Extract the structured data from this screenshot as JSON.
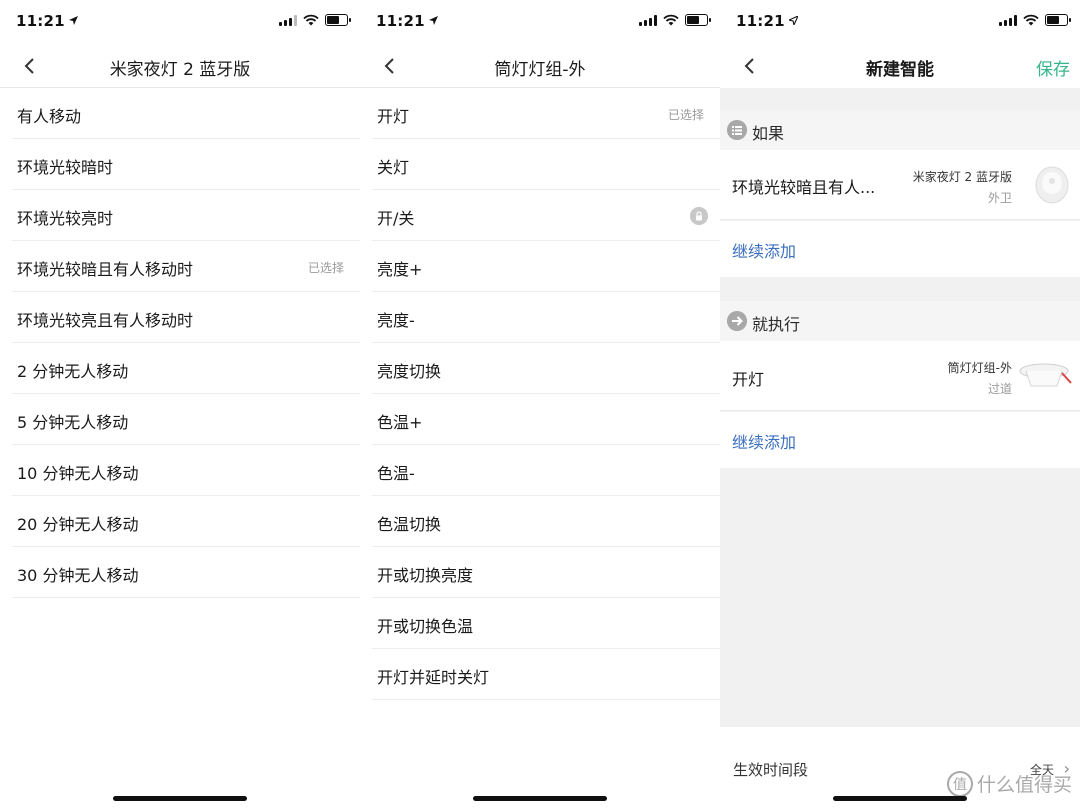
{
  "status": {
    "time": "11:21"
  },
  "panel1": {
    "title": "米家夜灯 2 蓝牙版",
    "items": [
      {
        "label": "有人移动",
        "tag": ""
      },
      {
        "label": "环境光较暗时",
        "tag": ""
      },
      {
        "label": "环境光较亮时",
        "tag": ""
      },
      {
        "label": "环境光较暗且有人移动时",
        "tag": "已选择"
      },
      {
        "label": "环境光较亮且有人移动时",
        "tag": ""
      },
      {
        "label": "2 分钟无人移动",
        "tag": ""
      },
      {
        "label": "5 分钟无人移动",
        "tag": ""
      },
      {
        "label": "10 分钟无人移动",
        "tag": ""
      },
      {
        "label": "20 分钟无人移动",
        "tag": ""
      },
      {
        "label": "30 分钟无人移动",
        "tag": ""
      }
    ]
  },
  "panel2": {
    "title": "筒灯灯组-外",
    "items": [
      {
        "label": "开灯",
        "tag": "已选择"
      },
      {
        "label": "关灯",
        "tag": ""
      },
      {
        "label": "开/关",
        "tag": ""
      },
      {
        "label": "亮度+",
        "tag": ""
      },
      {
        "label": "亮度-",
        "tag": ""
      },
      {
        "label": "亮度切换",
        "tag": ""
      },
      {
        "label": "色温+",
        "tag": ""
      },
      {
        "label": "色温-",
        "tag": ""
      },
      {
        "label": "色温切换",
        "tag": ""
      },
      {
        "label": "开或切换亮度",
        "tag": ""
      },
      {
        "label": "开或切换色温",
        "tag": ""
      },
      {
        "label": "开灯并延时关灯",
        "tag": ""
      }
    ]
  },
  "panel3": {
    "title": "新建智能",
    "save_label": "保存",
    "if_section": {
      "title": "如果",
      "condition": "环境光较暗且有人...",
      "device": "米家夜灯 2 蓝牙版",
      "room": "外卫",
      "add_label": "继续添加"
    },
    "then_section": {
      "title": "就执行",
      "action": "开灯",
      "device": "筒灯灯组-外",
      "room": "过道",
      "add_label": "继续添加"
    },
    "footer": {
      "label": "生效时间段",
      "value": "全天"
    },
    "watermark": {
      "logo": "值",
      "text": "什么值得买"
    }
  },
  "colors": {
    "accent_green": "#35b58a",
    "link_blue": "#3b6fbf"
  }
}
